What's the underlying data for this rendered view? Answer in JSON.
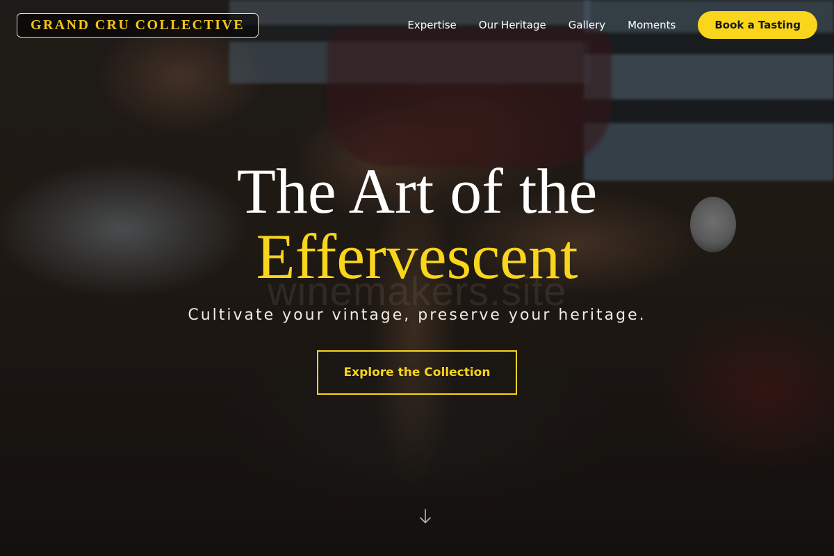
{
  "brand": {
    "name": "GRAND CRU COLLECTIVE"
  },
  "nav": {
    "links": [
      {
        "label": "Expertise"
      },
      {
        "label": "Our Heritage"
      },
      {
        "label": "Gallery"
      },
      {
        "label": "Moments"
      }
    ],
    "cta_label": "Book a Tasting"
  },
  "hero": {
    "title_line1": "The Art of the",
    "title_line2": "Effervescent",
    "subtitle": "Cultivate your vintage, preserve your heritage.",
    "button_label": "Explore the Collection",
    "watermark": "winemakers.site",
    "scroll_icon": "arrow-down-icon"
  },
  "colors": {
    "accent": "#f9d51c",
    "brand_text": "#f5c518",
    "text": "#ffffff"
  }
}
